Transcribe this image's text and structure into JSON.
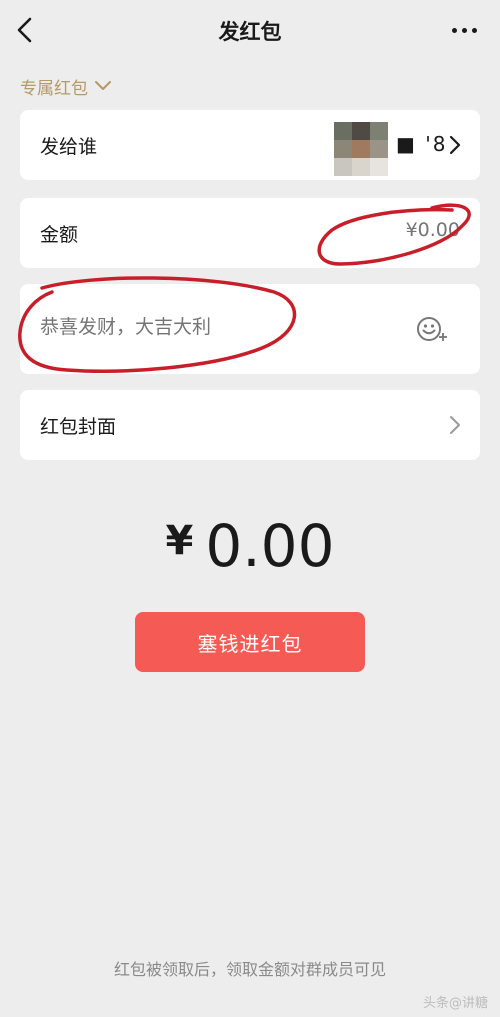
{
  "header": {
    "title": "发红包"
  },
  "packet_type": {
    "label": "专属红包"
  },
  "recipient": {
    "label": "发给谁",
    "value_suffix": "■ '8"
  },
  "amount": {
    "label": "金额",
    "placeholder": "¥0.00"
  },
  "greeting": {
    "placeholder": "恭喜发财，大吉大利"
  },
  "cover": {
    "label": "红包封面"
  },
  "total": {
    "currency": "¥",
    "value": "0.00"
  },
  "submit": {
    "label": "塞钱进红包"
  },
  "footer": {
    "note": "红包被领取后，领取金额对群成员可见"
  },
  "watermark": "头条@讲糖",
  "colors": {
    "accent_red": "#f55a54",
    "gold_text": "#b39a66",
    "annotation_red": "#c81e2a",
    "background": "#ededed"
  }
}
